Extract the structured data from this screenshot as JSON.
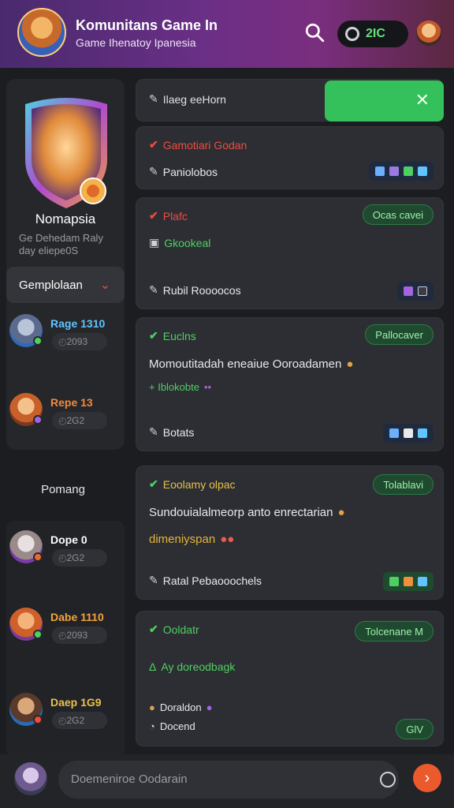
{
  "header": {
    "title": "Komunitans Game In",
    "subtitle": "Game Ihenatoy Ipanesia",
    "coin_value": "2IC"
  },
  "profile": {
    "name": "Nomapsia",
    "bio": "Ge Dehedam Raly day eliepe0S",
    "category": "Gemplolaan"
  },
  "members": [
    {
      "name": "Rage 1310",
      "stat": "2093",
      "color": "#5fc4ff"
    },
    {
      "name": "Repe 13",
      "stat": "2G2",
      "color": "#f08a3c"
    },
    {
      "name": "Dope 0",
      "stat": "2G2",
      "color": "#ffffff"
    },
    {
      "name": "Dabe 1110",
      "stat": "2093",
      "color": "#f2a33c"
    },
    {
      "name": "Daep 1G9",
      "stat": "2G2",
      "color": "#e7c04c"
    }
  ],
  "section_label": "Pomang",
  "toast": {
    "label": "Ilaeg eeHorn"
  },
  "cards": [
    {
      "status": "Gamotiari Godan",
      "line1": "Paniolobos"
    },
    {
      "status": "Plafc",
      "pill": "Ocas cavei",
      "line1": "Gkookeal",
      "line2": "Rubil Roooocos"
    },
    {
      "status": "Euclns",
      "pill": "Pallocaver",
      "body": "Momoutitadah eneaiue Ooroadamen",
      "tags": "+ Iblokobte",
      "line2": "Botats"
    },
    {
      "status": "Eoolamy olpac",
      "pill": "Tolablavi",
      "body": "Sundouialalmeorp anto enrectarian",
      "highlight": "dimeniyspan",
      "line2": "Ratal Pebaooochels"
    },
    {
      "status": "Ooldatr",
      "pill": "Tolcenane M",
      "line1": "Ay doreodbagk",
      "footer": "Doraldon",
      "footer2": "Docend",
      "pill2": "GlV"
    }
  ],
  "composer": {
    "placeholder": "Doemeniroe Oodarain"
  },
  "colors": {
    "accent_green": "#34c05a",
    "accent_orange": "#ea5a2d",
    "header_purple": "#6a2f86"
  }
}
